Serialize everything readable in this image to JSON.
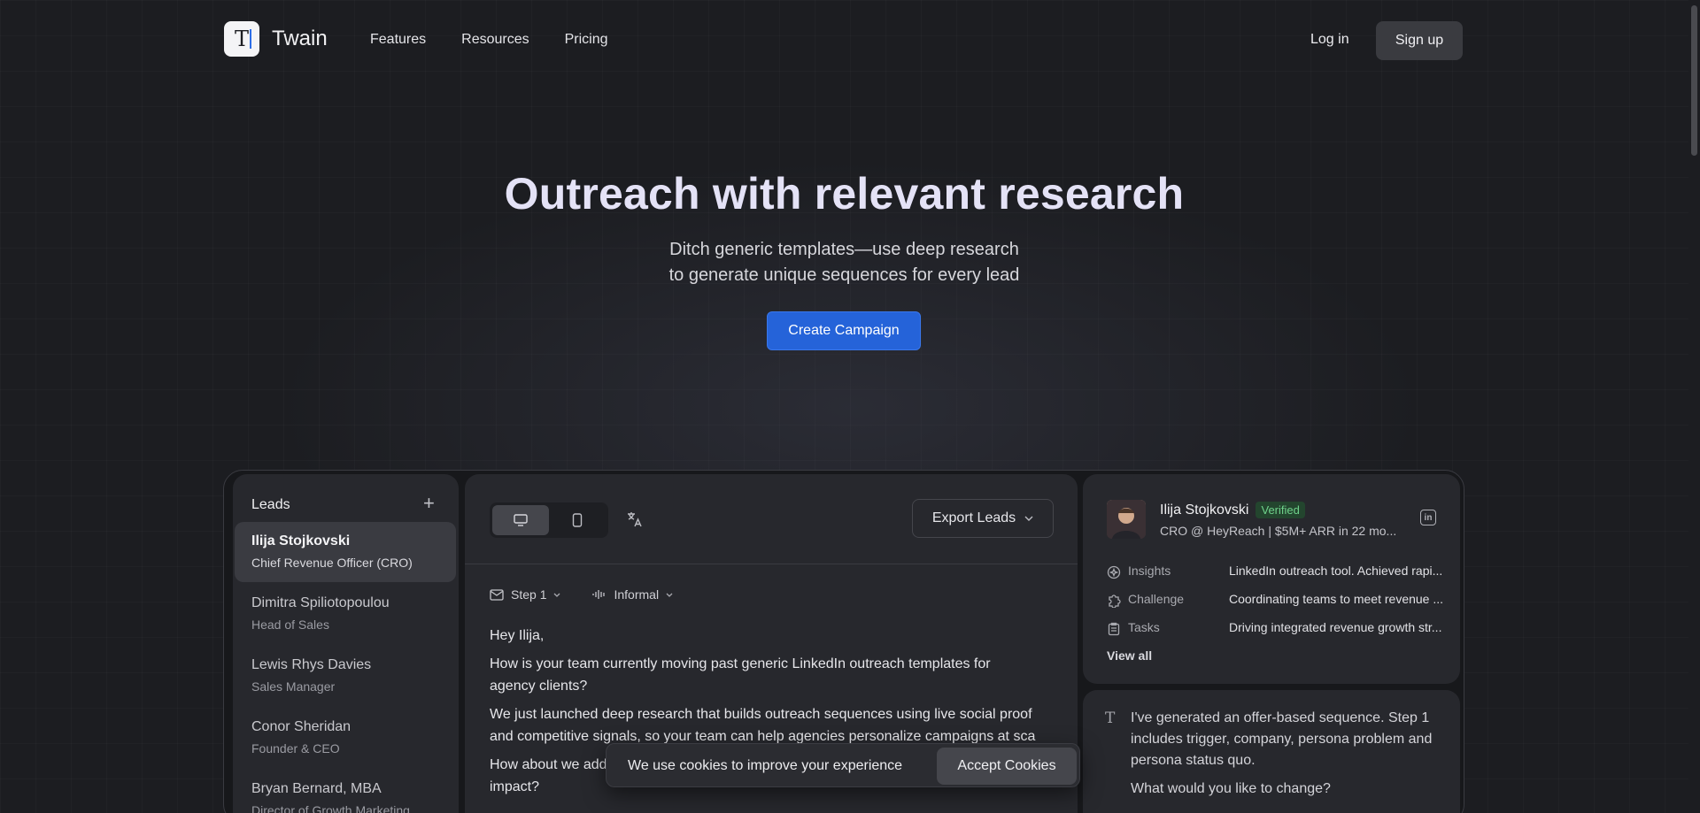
{
  "nav": {
    "brand": "Twain",
    "links": [
      "Features",
      "Resources",
      "Pricing"
    ],
    "login": "Log in",
    "signup": "Sign up"
  },
  "hero": {
    "title": "Outreach with relevant research",
    "subtitle_line1": "Ditch generic templates—use deep research",
    "subtitle_line2": "to generate unique sequences for every lead",
    "cta": "Create Campaign"
  },
  "leads": {
    "heading": "Leads",
    "items": [
      {
        "name": "Ilija Stojkovski",
        "role": "Chief Revenue Officer (CRO)"
      },
      {
        "name": "Dimitra Spiliotopoulou",
        "role": "Head of Sales"
      },
      {
        "name": "Lewis Rhys Davies",
        "role": "Sales Manager"
      },
      {
        "name": "Conor Sheridan",
        "role": "Founder & CEO"
      },
      {
        "name": "Bryan Bernard, MBA",
        "role": "Director of Growth Marketing"
      }
    ]
  },
  "editor": {
    "export_label": "Export Leads",
    "step_label": "Step 1",
    "tone_label": "Informal",
    "email": [
      "Hey Ilija,",
      "How is your team currently moving past generic LinkedIn outreach templates for agency clients?",
      "We just launched deep research that builds outreach sequences using live social proof and competitive signals, so your team can help agencies personalize campaigns at sca",
      "How about we add",
      "impact?"
    ]
  },
  "profile": {
    "name": "Ilija Stojkovski",
    "verified": "Verified",
    "role": "CRO @ HeyReach | $5M+ ARR in 22 mo...",
    "rows": [
      {
        "key": "Insights",
        "value": "LinkedIn outreach tool. Achieved rapi..."
      },
      {
        "key": "Challenge",
        "value": "Coordinating teams to meet revenue ..."
      },
      {
        "key": "Tasks",
        "value": "Driving integrated revenue growth str..."
      }
    ],
    "view_all": "View all"
  },
  "chat": {
    "message": "I've generated an offer-based sequence. Step 1 includes trigger, company, persona problem and persona status quo.",
    "question": "What would you like to change?"
  },
  "cookie": {
    "text": "We use cookies to improve your experience",
    "accept": "Accept Cookies"
  },
  "colors": {
    "background": "#1c1d21",
    "accent": "#2563d9",
    "verified": "#6fd28b"
  }
}
